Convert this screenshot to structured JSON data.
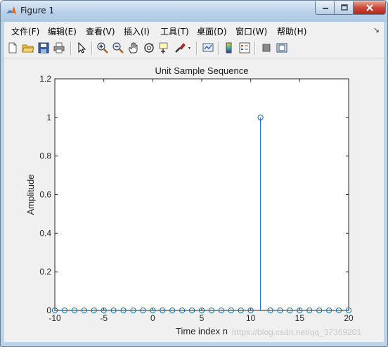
{
  "window": {
    "title": "Figure 1"
  },
  "menu": {
    "items": [
      "文件(F)",
      "编辑(E)",
      "查看(V)",
      "插入(I)",
      "工具(T)",
      "桌面(D)",
      "窗口(W)",
      "帮助(H)"
    ],
    "overflow": "↘"
  },
  "toolbar": {
    "icons": [
      "new-figure-icon",
      "open-file-icon",
      "save-icon",
      "print-icon",
      "select-pointer-icon",
      "zoom-in-icon",
      "zoom-out-icon",
      "pan-hand-icon",
      "rotate-3d-icon",
      "data-cursor-icon",
      "brush-icon",
      "link-plot-icon",
      "colorbar-icon",
      "legend-icon",
      "hide-plot-tools-icon",
      "show-plot-tools-icon"
    ]
  },
  "watermark": "https://blog.csdn.net/qq_37369201",
  "chart_data": {
    "type": "stem",
    "title": "Unit Sample Sequence",
    "xlabel": "Time index n",
    "ylabel": "Amplitude",
    "x": [
      -10,
      -9,
      -8,
      -7,
      -6,
      -5,
      -4,
      -3,
      -2,
      -1,
      0,
      1,
      2,
      3,
      4,
      5,
      6,
      7,
      8,
      9,
      10,
      11,
      12,
      13,
      14,
      15,
      16,
      17,
      18,
      19,
      20
    ],
    "y": [
      0,
      0,
      0,
      0,
      0,
      0,
      0,
      0,
      0,
      0,
      0,
      0,
      0,
      0,
      0,
      0,
      0,
      0,
      0,
      0,
      0,
      1,
      0,
      0,
      0,
      0,
      0,
      0,
      0,
      0,
      0
    ],
    "xlim": [
      -10,
      20
    ],
    "ylim": [
      0,
      1.2
    ],
    "xticks": [
      -10,
      -5,
      0,
      5,
      10,
      15,
      20
    ],
    "yticks": [
      0,
      0.2,
      0.4,
      0.6,
      0.8,
      1,
      1.2
    ],
    "series_color": "#0072BD",
    "grid": false
  }
}
